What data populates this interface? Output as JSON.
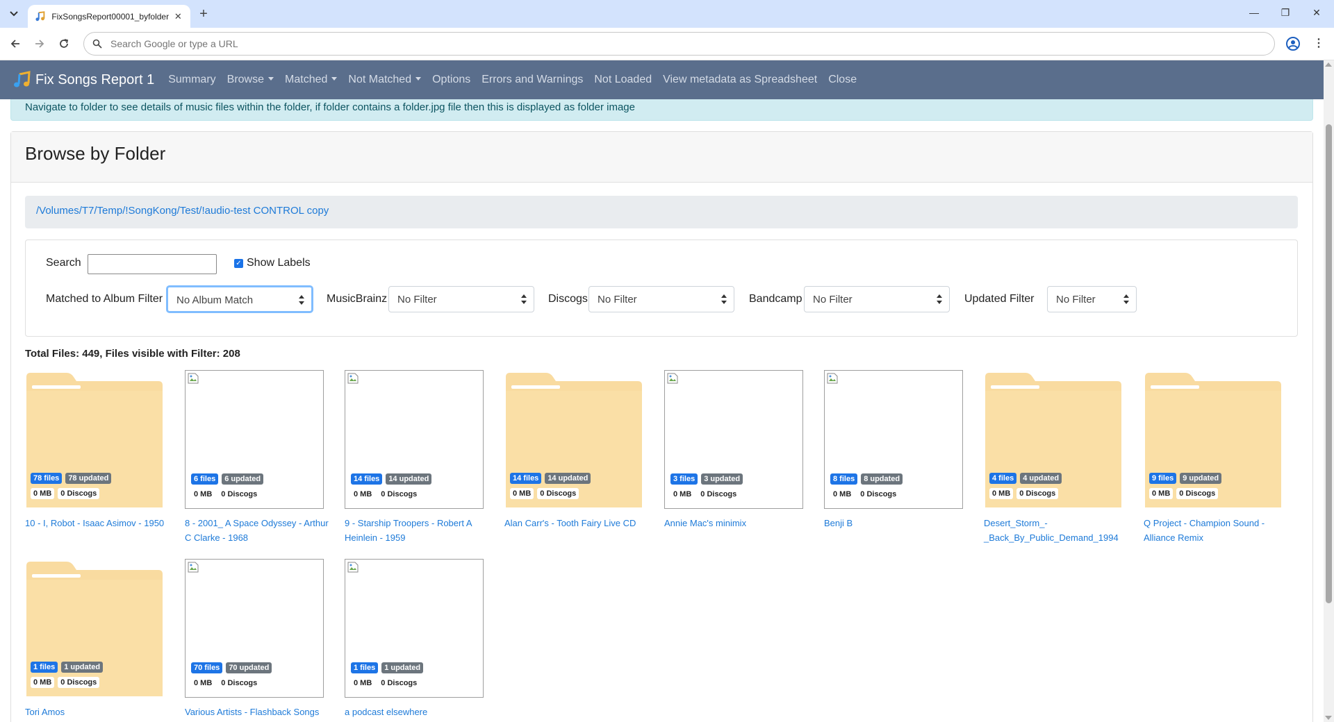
{
  "browser": {
    "tab_title": "FixSongsReport00001_byfolder",
    "address_placeholder": "Search Google or type a URL"
  },
  "navbar": {
    "brand": "Fix Songs Report 1",
    "links": [
      {
        "label": "Summary",
        "dropdown": false
      },
      {
        "label": "Browse",
        "dropdown": true
      },
      {
        "label": "Matched",
        "dropdown": true
      },
      {
        "label": "Not Matched",
        "dropdown": true
      },
      {
        "label": "Options",
        "dropdown": false
      },
      {
        "label": "Errors and Warnings",
        "dropdown": false
      },
      {
        "label": "Not Loaded",
        "dropdown": false
      },
      {
        "label": "View metadata as Spreadsheet",
        "dropdown": false
      },
      {
        "label": "Close",
        "dropdown": false
      }
    ]
  },
  "info_alert": "Navigate to folder to see details of music files within the folder, if folder contains a folder.jpg file then this is displayed as folder image",
  "page_title": "Browse by Folder",
  "breadcrumb": "/Volumes/T7/Temp/!SongKong/Test/!audio-test CONTROL copy",
  "filters": {
    "search_label": "Search",
    "search_value": "",
    "show_labels_label": "Show Labels",
    "show_labels_checked": true,
    "album_filter_label": "Matched to Album Filter",
    "album_filter_value": "No Album Match",
    "musicbrainz_label": "MusicBrainz",
    "musicbrainz_value": "No Filter",
    "discogs_label": "Discogs",
    "discogs_value": "No Filter",
    "bandcamp_label": "Bandcamp",
    "bandcamp_value": "No Filter",
    "updated_label": "Updated Filter",
    "updated_value": "No Filter"
  },
  "totals": "Total Files: 449, Files visible with Filter: 208",
  "folders": [
    {
      "name": "10 - I, Robot - Isaac Asimov - 1950",
      "files": "78 files",
      "updated": "78 updated",
      "mb": "0 MB",
      "discogs": "0 Discogs",
      "thumb": "folder"
    },
    {
      "name": "8 - 2001_ A Space Odyssey - Arthur C Clarke - 1968",
      "files": "6 files",
      "updated": "6 updated",
      "mb": "0 MB",
      "discogs": "0 Discogs",
      "thumb": "image"
    },
    {
      "name": "9 - Starship Troopers - Robert A Heinlein - 1959",
      "files": "14 files",
      "updated": "14 updated",
      "mb": "0 MB",
      "discogs": "0 Discogs",
      "thumb": "image"
    },
    {
      "name": "Alan Carr's - Tooth Fairy Live CD",
      "files": "14 files",
      "updated": "14 updated",
      "mb": "0 MB",
      "discogs": "0 Discogs",
      "thumb": "folder"
    },
    {
      "name": "Annie Mac's minimix",
      "files": "3 files",
      "updated": "3 updated",
      "mb": "0 MB",
      "discogs": "0 Discogs",
      "thumb": "image"
    },
    {
      "name": "Benji B",
      "files": "8 files",
      "updated": "8 updated",
      "mb": "0 MB",
      "discogs": "0 Discogs",
      "thumb": "image"
    },
    {
      "name": "Desert_Storm_-_Back_By_Public_Demand_1994",
      "files": "4 files",
      "updated": "4 updated",
      "mb": "0 MB",
      "discogs": "0 Discogs",
      "thumb": "folder"
    },
    {
      "name": "Q Project - Champion Sound - Alliance Remix",
      "files": "9 files",
      "updated": "9 updated",
      "mb": "0 MB",
      "discogs": "0 Discogs",
      "thumb": "folder"
    },
    {
      "name": "Tori Amos",
      "files": "1 files",
      "updated": "1 updated",
      "mb": "0 MB",
      "discogs": "0 Discogs",
      "thumb": "folder"
    },
    {
      "name": "Various Artists - Flashback Songs",
      "files": "70 files",
      "updated": "70 updated",
      "mb": "0 MB",
      "discogs": "0 Discogs",
      "thumb": "image"
    },
    {
      "name": "a podcast elsewhere",
      "files": "1 files",
      "updated": "1 updated",
      "mb": "0 MB",
      "discogs": "0 Discogs",
      "thumb": "image"
    }
  ]
}
